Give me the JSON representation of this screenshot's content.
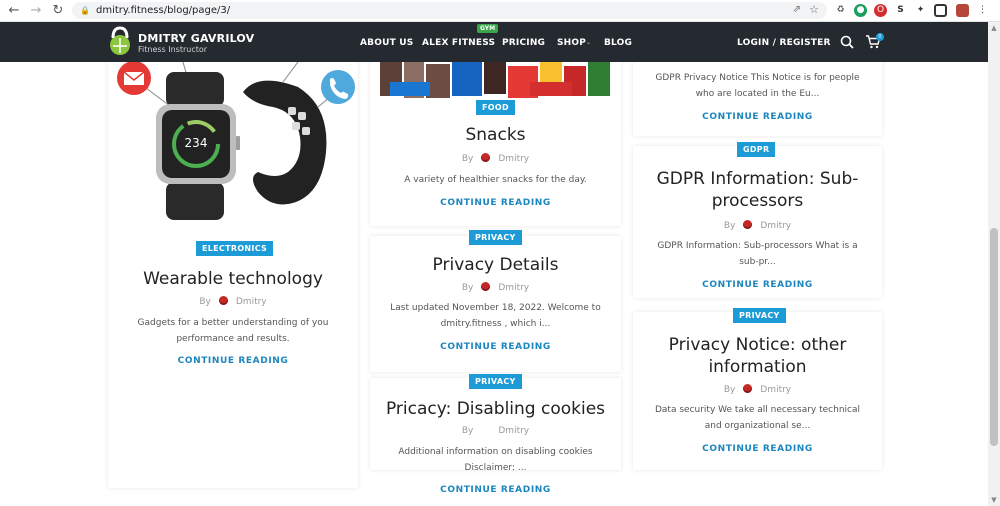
{
  "browser": {
    "url": "dmitry.fitness/blog/page/3/"
  },
  "site": {
    "brand_name": "DMITRY GAVRILOV",
    "brand_tagline": "Fitness Instructor",
    "gym_badge": "GYM",
    "menu": [
      "ABOUT US",
      "ALEX FITNESS",
      "PRICING",
      "SHOP",
      "BLOG"
    ],
    "login_label": "LOGIN / REGISTER",
    "cart_count": "0",
    "accent_color": "#1d9bd7",
    "header_color": "#242a30"
  },
  "posts": {
    "wearable": {
      "tag": "ELECTRONICS",
      "title": "Wearable technology",
      "by": "By",
      "author": "Dmitry",
      "excerpt": "Gadgets for a better understanding of you performance and results.",
      "readmore": "CONTINUE READING",
      "watch_readout": "234"
    },
    "snacks": {
      "tag": "FOOD",
      "title": "Snacks",
      "by": "By",
      "author": "Dmitry",
      "excerpt": "A variety of healthier snacks for the day.",
      "readmore": "CONTINUE READING"
    },
    "privacy_details": {
      "tag": "PRIVACY",
      "title": "Privacy Details",
      "by": "By",
      "author": "Dmitry",
      "excerpt": "Last updated November 18, 2022. Welcome to dmitry.fitness , which i...",
      "readmore": "CONTINUE READING"
    },
    "disabling_cookies": {
      "tag": "PRIVACY",
      "title": "Pricacy: Disabling cookies",
      "by": "By",
      "author": "Dmitry",
      "excerpt": "Additional information on disabling cookies Disclaimer: ...",
      "readmore": "CONTINUE READING"
    },
    "gdpr_notice": {
      "excerpt": "GDPR Privacy Notice This Notice is for people who are located in the Eu...",
      "readmore": "CONTINUE READING"
    },
    "gdpr_subprocessors": {
      "tag": "GDPR",
      "title": "GDPR Information: Sub-processors",
      "by": "By",
      "author": "Dmitry",
      "excerpt": "GDPR Information: Sub-processors What is a sub-pr...",
      "readmore": "CONTINUE READING"
    },
    "privacy_other": {
      "tag": "PRIVACY",
      "title": "Privacy Notice: other information",
      "by": "By",
      "author": "Dmitry",
      "excerpt": "Data security We take all necessary technical and organizational se...",
      "readmore": "CONTINUE READING"
    }
  }
}
